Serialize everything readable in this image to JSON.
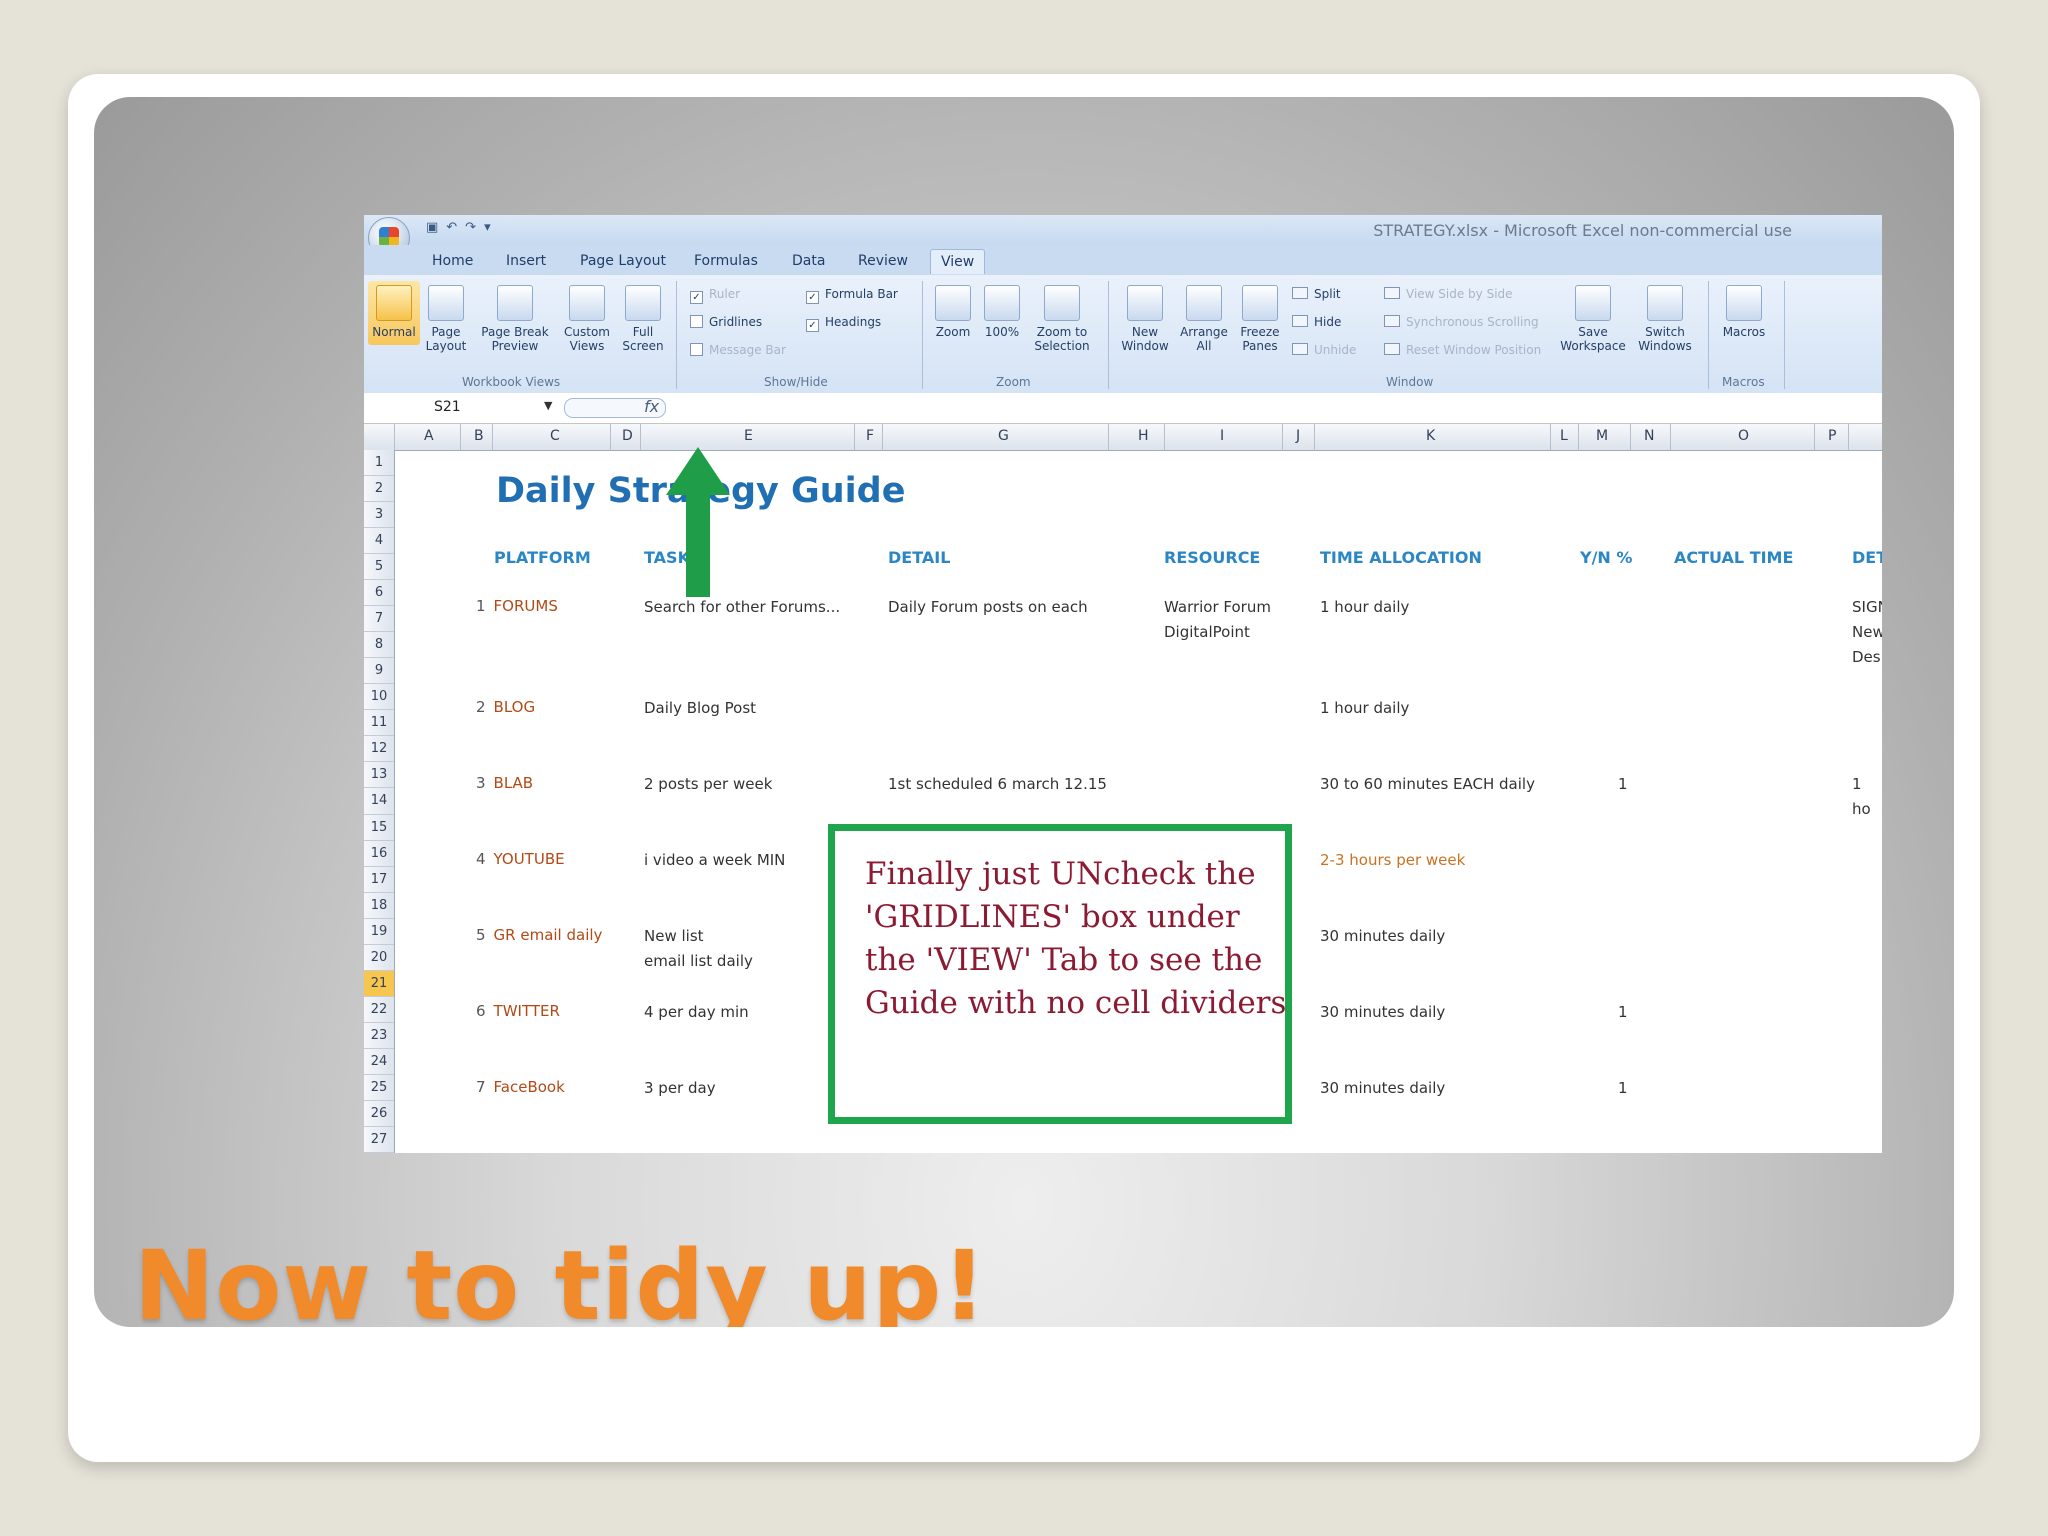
{
  "window": {
    "title": "STRATEGY.xlsx - Microsoft Excel non-commercial use"
  },
  "tabs": [
    "Home",
    "Insert",
    "Page Layout",
    "Formulas",
    "Data",
    "Review",
    "View"
  ],
  "ribbon": {
    "workbook_views": {
      "label": "Workbook Views",
      "buttons": [
        "Normal",
        "Page Layout",
        "Page Break Preview",
        "Custom Views",
        "Full Screen"
      ]
    },
    "show_hide": {
      "label": "Show/Hide",
      "ruler": "Ruler",
      "gridlines": "Gridlines",
      "message_bar": "Message Bar",
      "formula_bar": "Formula Bar",
      "headings": "Headings"
    },
    "zoom": {
      "label": "Zoom",
      "buttons": [
        "Zoom",
        "100%",
        "Zoom to Selection"
      ]
    },
    "window": {
      "label": "Window",
      "buttons": [
        "New Window",
        "Arrange All",
        "Freeze Panes"
      ],
      "split": "Split",
      "hide": "Hide",
      "unhide": "Unhide",
      "side_by_side": "View Side by Side",
      "sync_scroll": "Synchronous Scrolling",
      "reset_pos": "Reset Window Position",
      "save_ws": "Save Workspace",
      "switch": "Switch Windows"
    },
    "macros": {
      "label": "Macros",
      "button": "Macros"
    }
  },
  "formula_bar": {
    "name_box": "S21",
    "fx": "fx"
  },
  "columns": [
    "A",
    "B",
    "C",
    "D",
    "E",
    "F",
    "G",
    "H",
    "I",
    "J",
    "K",
    "L",
    "M",
    "N",
    "O",
    "P"
  ],
  "rows": [
    "1",
    "2",
    "3",
    "4",
    "5",
    "6",
    "7",
    "8",
    "9",
    "10",
    "11",
    "12",
    "13",
    "14",
    "15",
    "16",
    "17",
    "18",
    "19",
    "20",
    "21",
    "22",
    "23",
    "24",
    "25",
    "26",
    "27"
  ],
  "sheet": {
    "title": "Daily Strategy Guide",
    "headers": [
      "PLATFORM",
      "TASK",
      "DETAIL",
      "RESOURCE",
      "TIME ALLOCATION",
      "Y/N %",
      "ACTUAL TIME",
      "DET"
    ],
    "items": [
      {
        "num": "1",
        "platform": "FORUMS",
        "task": "Search for other Forums...",
        "detail": "Daily Forum posts on each",
        "resource1": "Warrior Forum",
        "resource2": "DigitalPoint",
        "time": "1 hour daily",
        "yn": "",
        "det": [
          "SIGN",
          "New",
          "Des"
        ]
      },
      {
        "num": "2",
        "platform": "BLOG",
        "task": "Daily Blog Post",
        "detail": "",
        "time": "1 hour daily",
        "yn": ""
      },
      {
        "num": "3",
        "platform": "BLAB",
        "task": "2 posts per week",
        "detail": "1st scheduled 6 march 12.15",
        "time": "30 to 60 minutes EACH daily",
        "yn": "1",
        "det": [
          "1 ho"
        ]
      },
      {
        "num": "4",
        "platform": "YOUTUBE",
        "task": "i video a week MIN",
        "time": "2-3 hours per week",
        "yn": ""
      },
      {
        "num": "5",
        "platform": "GR email daily",
        "task": "New list",
        "task2": "email list daily",
        "time": "30 minutes daily",
        "yn": ""
      },
      {
        "num": "6",
        "platform": "TWITTER",
        "task": "4 per day min",
        "time": "30 minutes daily",
        "yn": "1"
      },
      {
        "num": "7",
        "platform": "FaceBook",
        "task": "3 per day",
        "time": "30 minutes daily",
        "yn": "1"
      }
    ]
  },
  "callout": {
    "text": "Finally just UNcheck the\n'GRIDLINES' box under\nthe 'VIEW' Tab to see the\nGuide with no cell dividers"
  },
  "slide_title": "Now to tidy up!",
  "colors": {
    "accent_orange": "#f08a2a",
    "callout_border": "#1fa64d",
    "callout_text": "#8b1a32",
    "title_blue": "#1f6fb2"
  }
}
